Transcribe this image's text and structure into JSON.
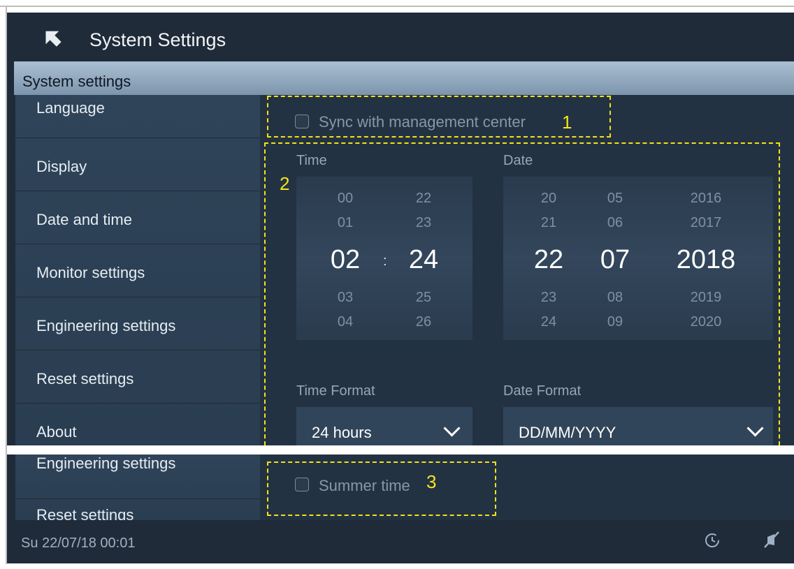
{
  "header": {
    "title": "System Settings",
    "back_icon": "back-arrow-icon"
  },
  "subheader": {
    "title": "System settings"
  },
  "sidebar": {
    "items": [
      {
        "label": "Language"
      },
      {
        "label": "Display"
      },
      {
        "label": "Date and time"
      },
      {
        "label": "Monitor settings"
      },
      {
        "label": "Engineering settings"
      },
      {
        "label": "Reset settings"
      },
      {
        "label": "About"
      }
    ]
  },
  "sync": {
    "label": "Sync with management center",
    "checked": false,
    "annotation": "1"
  },
  "datetime": {
    "annotation": "2",
    "time_label": "Time",
    "date_label": "Date",
    "hours": {
      "above": [
        "00",
        "01"
      ],
      "selected": "02",
      "below": [
        "03",
        "04"
      ]
    },
    "separator": ":",
    "minutes": {
      "above": [
        "22",
        "23"
      ],
      "selected": "24",
      "below": [
        "25",
        "26"
      ]
    },
    "days": {
      "above": [
        "20",
        "21"
      ],
      "selected": "22",
      "below": [
        "23",
        "24"
      ]
    },
    "months": {
      "above": [
        "05",
        "06"
      ],
      "selected": "07",
      "below": [
        "08",
        "09"
      ]
    },
    "years": {
      "above": [
        "2016",
        "2017"
      ],
      "selected": "2018",
      "below": [
        "2019",
        "2020"
      ]
    },
    "time_format_label": "Time Format",
    "time_format_value": "24 hours",
    "date_format_label": "Date Format",
    "date_format_value": "DD/MM/YYYY"
  },
  "lower": {
    "sidebar_items": [
      {
        "label": "Engineering settings"
      },
      {
        "label": "Reset settings"
      }
    ],
    "summer": {
      "label": "Summer time",
      "checked": false,
      "annotation": "3"
    }
  },
  "status": {
    "datetime": "Su 22/07/18  00:01",
    "icons": [
      "history-icon",
      "mute-icon"
    ]
  },
  "colors": {
    "background": "#1f2b39",
    "sidebar": "#2f4459",
    "highlight": "#f3e21a",
    "accent_bar": "#a9bfd3"
  }
}
